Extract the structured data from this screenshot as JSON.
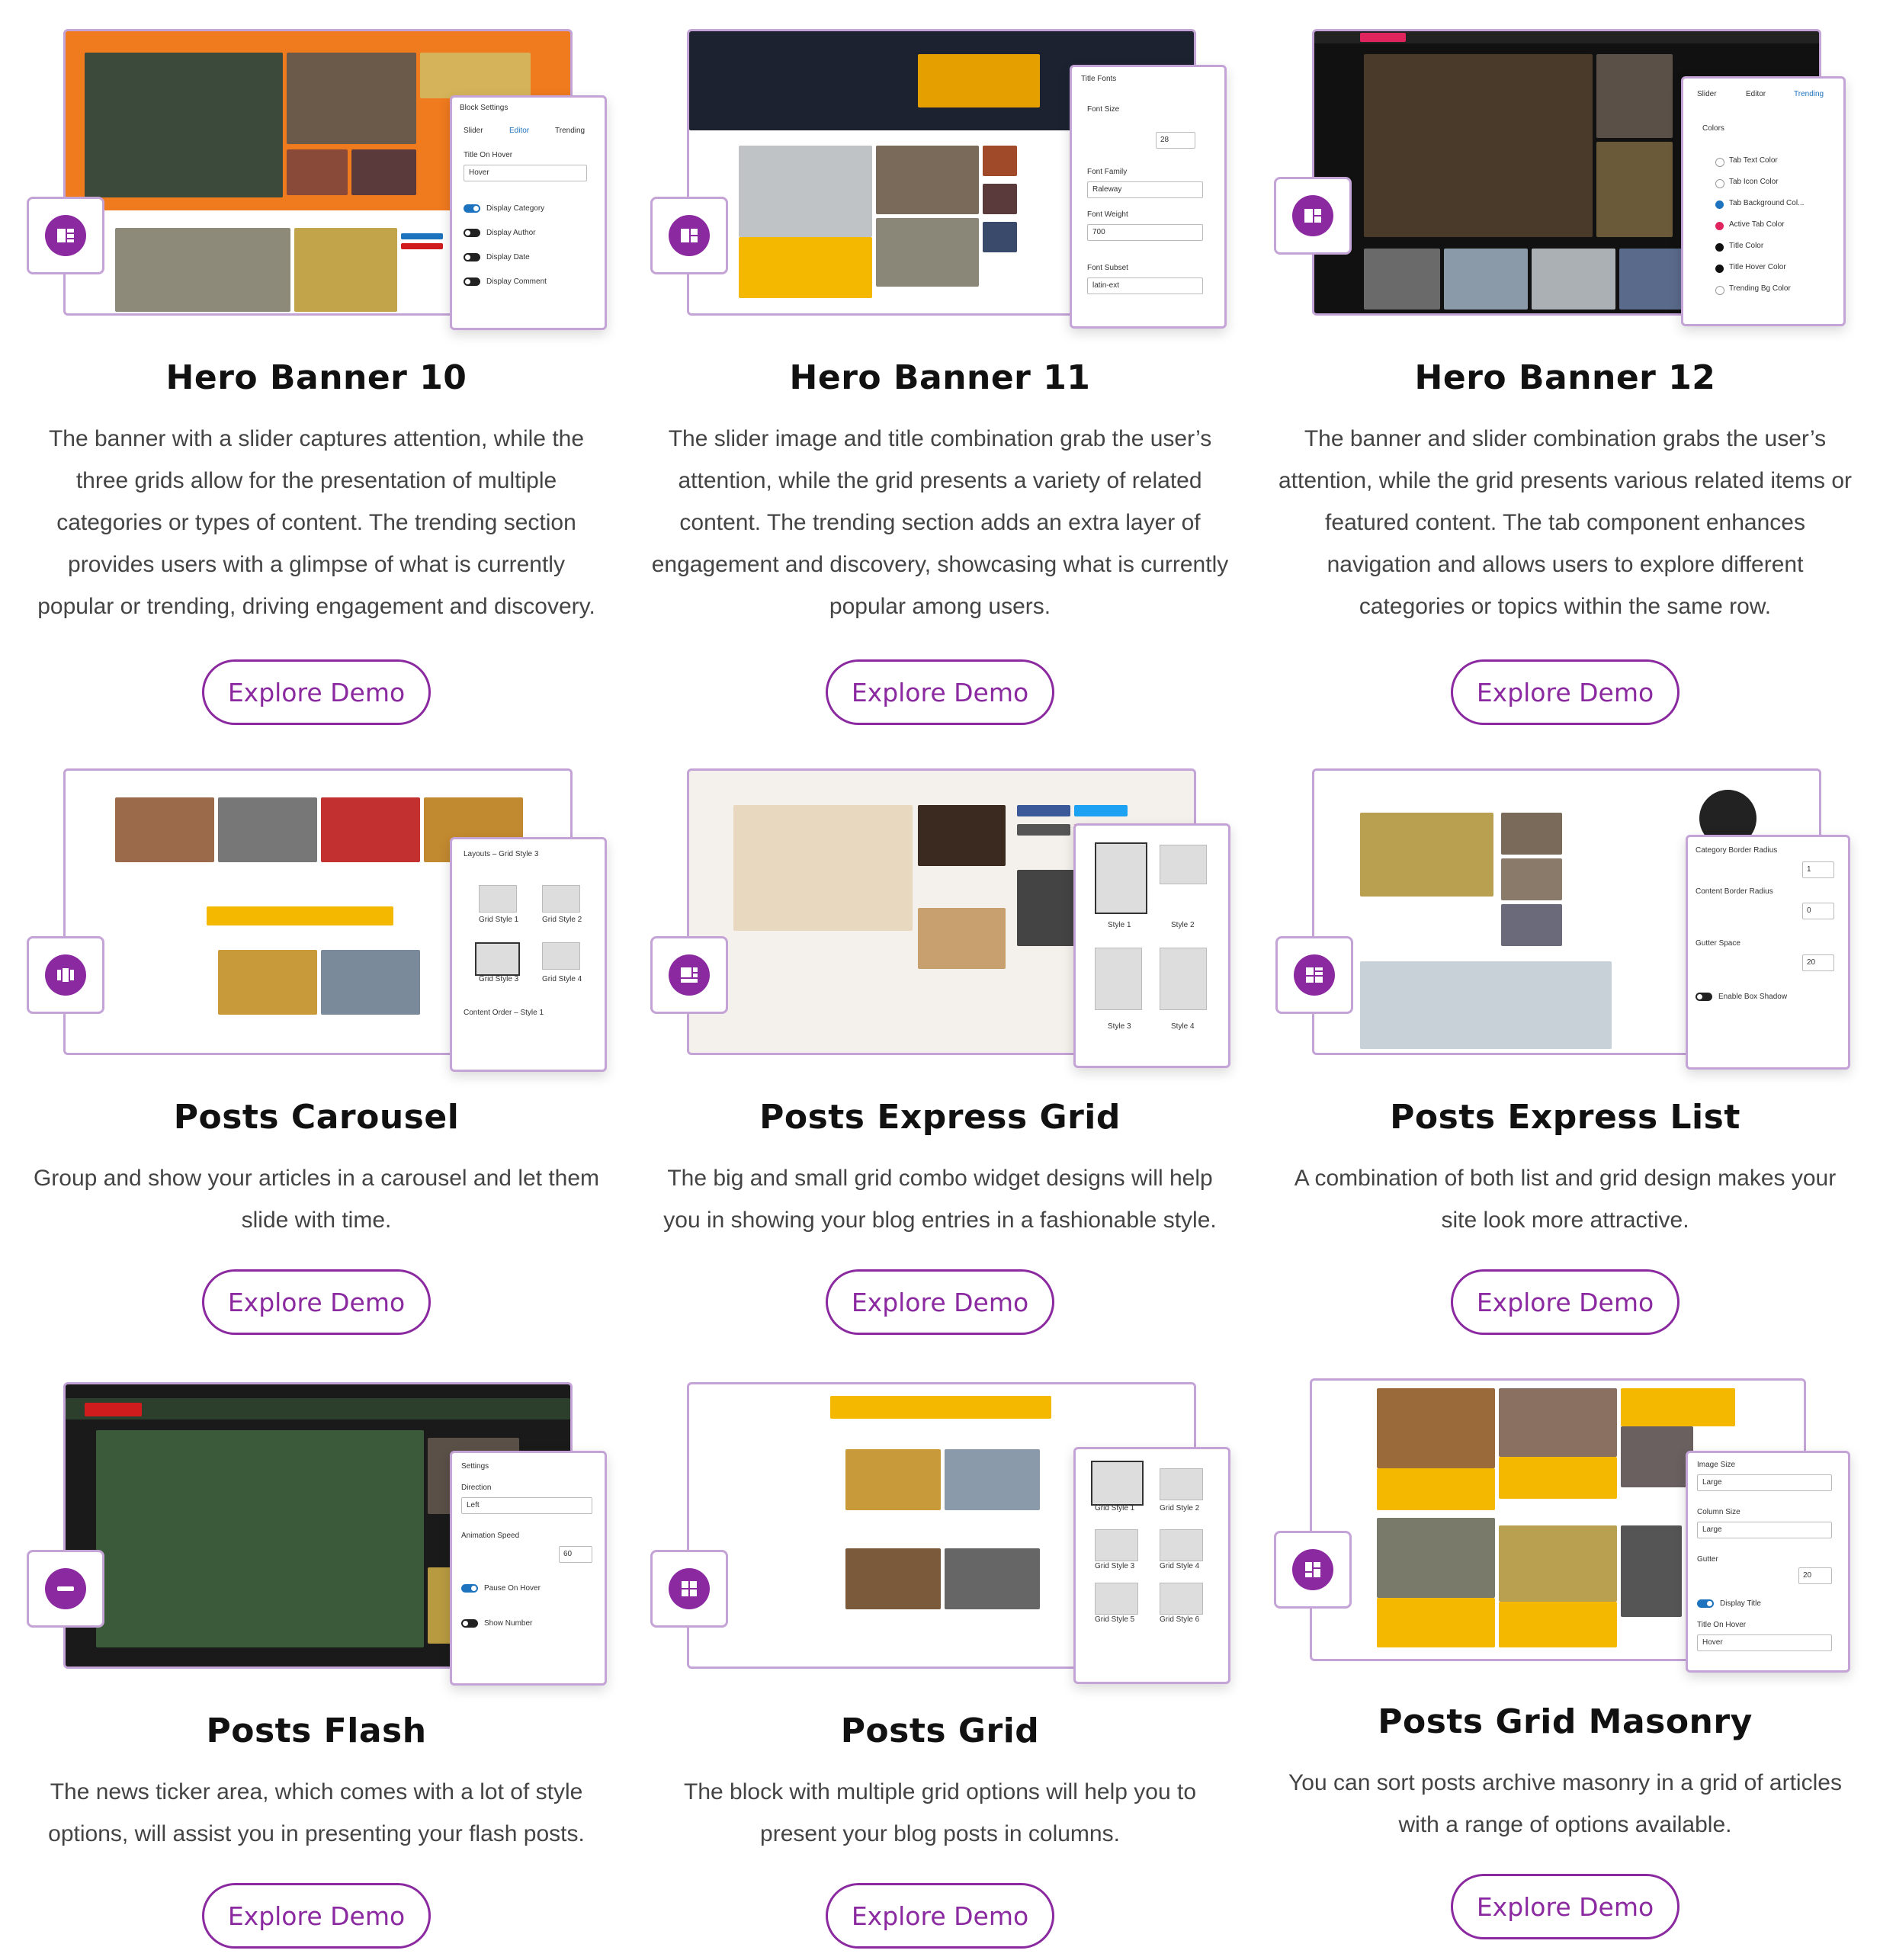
{
  "button_label": "Explore Demo",
  "cards": [
    {
      "title": "Hero Banner 10",
      "desc": "The banner with a slider captures attention, while the three grids allow for the presentation of multiple categories or types of content. The trending section provides users with a glimpse of what is currently popular or trending, driving engagement and discovery.",
      "panel": {
        "heading": "Block Settings",
        "tabs": [
          "Slider",
          "Editor",
          "Trending"
        ],
        "field_label": "Title On Hover",
        "field_value": "Hover",
        "toggles": [
          "Display Category",
          "Display Author",
          "Display Date",
          "Display Comment"
        ]
      }
    },
    {
      "title": "Hero Banner 11",
      "desc": "The slider image and title combination grab the user’s attention, while the grid presents a variety of related content. The trending section adds an extra layer of engagement and discovery, showcasing what is currently popular among users.",
      "panel": {
        "heading": "Title Fonts",
        "labels": [
          "Font Size",
          "Font Family",
          "Font Weight",
          "Font Subset"
        ],
        "values": [
          "28",
          "Raleway",
          "700",
          "latin-ext"
        ]
      }
    },
    {
      "title": "Hero Banner 12",
      "desc": "The banner and slider combination grabs the user’s attention, while the grid presents various related items or featured content. The tab component enhances navigation and allows users to explore different categories or topics within the same row.",
      "panel": {
        "tabs": [
          "Slider",
          "Editor",
          "Trending"
        ],
        "heading": "Colors",
        "items": [
          "Tab Text Color",
          "Tab Icon Color",
          "Tab Background Col...",
          "Active Tab Color",
          "Title Color",
          "Title Hover Color",
          "Trending Bg Color"
        ]
      }
    },
    {
      "title": "Posts Carousel",
      "desc": "Group and show your articles in a carousel and let them slide with time.",
      "panel": {
        "heading": "Layouts – Grid Style 3",
        "styles": [
          "Grid Style 1",
          "Grid Style 2",
          "Grid Style 3",
          "Grid Style 4"
        ],
        "footer": "Content Order – Style 1"
      }
    },
    {
      "title": "Posts Express Grid",
      "desc": "The big and small grid combo widget designs will help you in showing your blog entries in a fashionable style.",
      "panel": {
        "styles": [
          "Style 1",
          "Style 2",
          "Style 3",
          "Style 4"
        ]
      }
    },
    {
      "title": "Posts Express List",
      "desc": "A combination of both list and grid design makes your site look more attractive.",
      "panel": {
        "labels": [
          "Category Border Radius",
          "Content Border Radius",
          "Gutter Space"
        ],
        "values": [
          "1",
          "0",
          "20"
        ],
        "toggle": "Enable Box Shadow"
      }
    },
    {
      "title": "Posts Flash",
      "desc": "The news ticker area, which comes with a lot of style options, will assist you in presenting your flash posts.",
      "panel": {
        "heading": "Settings",
        "labels": [
          "Direction",
          "Animation Speed"
        ],
        "values": [
          "Left",
          "60"
        ],
        "toggles": [
          "Pause On Hover",
          "Show Number"
        ]
      }
    },
    {
      "title": "Posts Grid",
      "desc": "The block with multiple grid options will help you to present your blog posts in columns.",
      "panel": {
        "styles": [
          "Grid Style 1",
          "Grid Style 2",
          "Grid Style 3",
          "Grid Style 4",
          "Grid Style 5",
          "Grid Style 6"
        ]
      }
    },
    {
      "title": "Posts Grid Masonry",
      "desc": "You can sort posts archive masonry in a grid of articles with a range of options available.",
      "panel": {
        "labels": [
          "Image Size",
          "Column Size",
          "Gutter",
          "Title On Hover"
        ],
        "values": [
          "Large",
          "Large",
          "20",
          "Hover"
        ],
        "toggle": "Display Title"
      }
    }
  ],
  "colors": {
    "accent": "#8b2aa0",
    "border": "#c4a3d6",
    "orange": "#f57c00",
    "yellow": "#f5b800"
  }
}
